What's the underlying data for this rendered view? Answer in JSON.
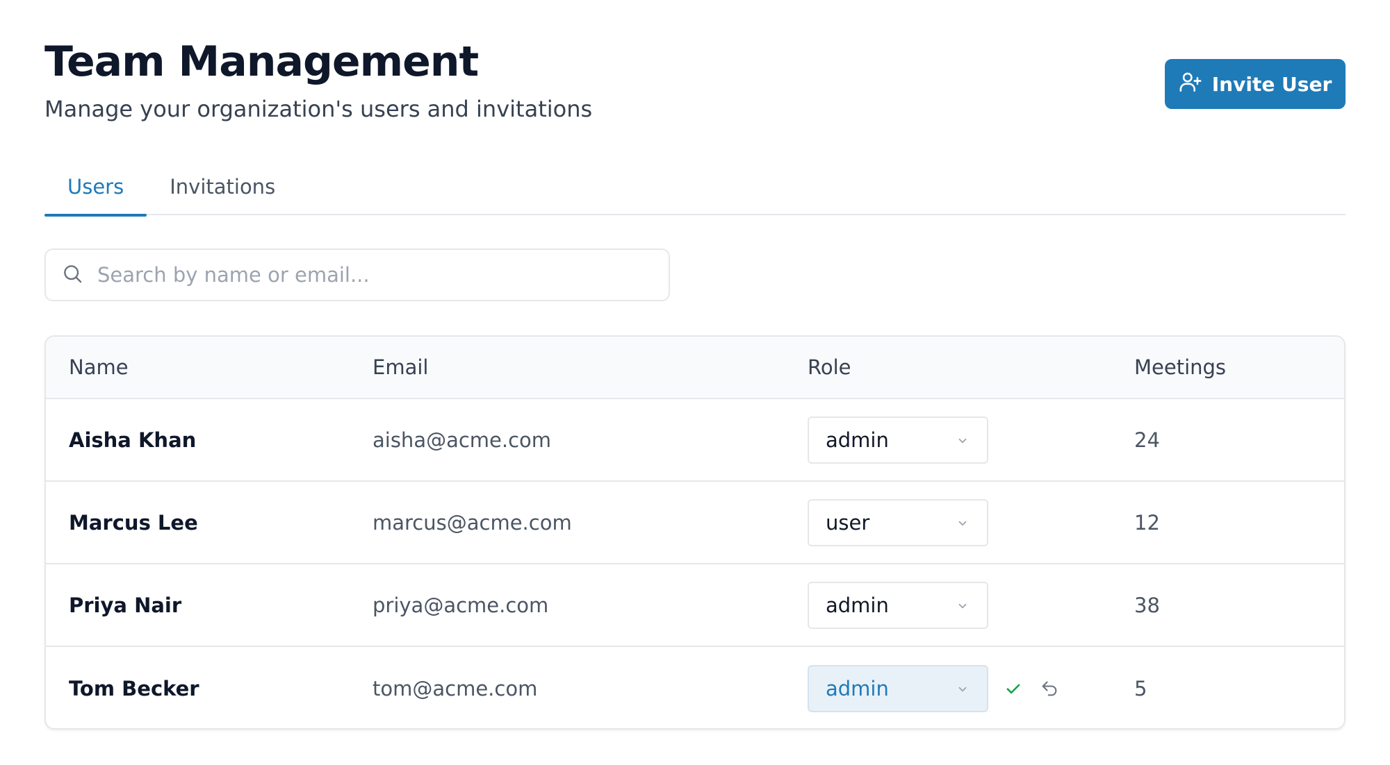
{
  "header": {
    "title": "Team Management",
    "subtitle": "Manage your organization's users and invitations",
    "invite_label": "Invite User"
  },
  "tabs": [
    {
      "label": "Users",
      "active": true
    },
    {
      "label": "Invitations",
      "active": false
    }
  ],
  "search": {
    "placeholder": "Search by name or email...",
    "value": ""
  },
  "table": {
    "columns": [
      "Name",
      "Email",
      "Role",
      "Meetings"
    ],
    "rows": [
      {
        "name": "Aisha Khan",
        "email": "aisha@acme.com",
        "role": "admin",
        "meetings": "24"
      },
      {
        "name": "Marcus Lee",
        "email": "marcus@acme.com",
        "role": "user",
        "meetings": "12"
      },
      {
        "name": "Priya Nair",
        "email": "priya@acme.com",
        "role": "admin",
        "meetings": "38"
      },
      {
        "name": "Tom Becker",
        "email": "tom@acme.com",
        "role": "admin",
        "meetings": "5"
      }
    ]
  },
  "icons": {
    "invite": "user-plus-icon",
    "search": "search-icon",
    "dropdown": "chevron-down-icon",
    "confirm": "check-icon",
    "undo": "undo-icon"
  },
  "colors": {
    "accent": "#1f7ab8",
    "confirm": "#16a34a",
    "border": "#e5e7eb",
    "dirty_bg": "#e8f1f8"
  }
}
